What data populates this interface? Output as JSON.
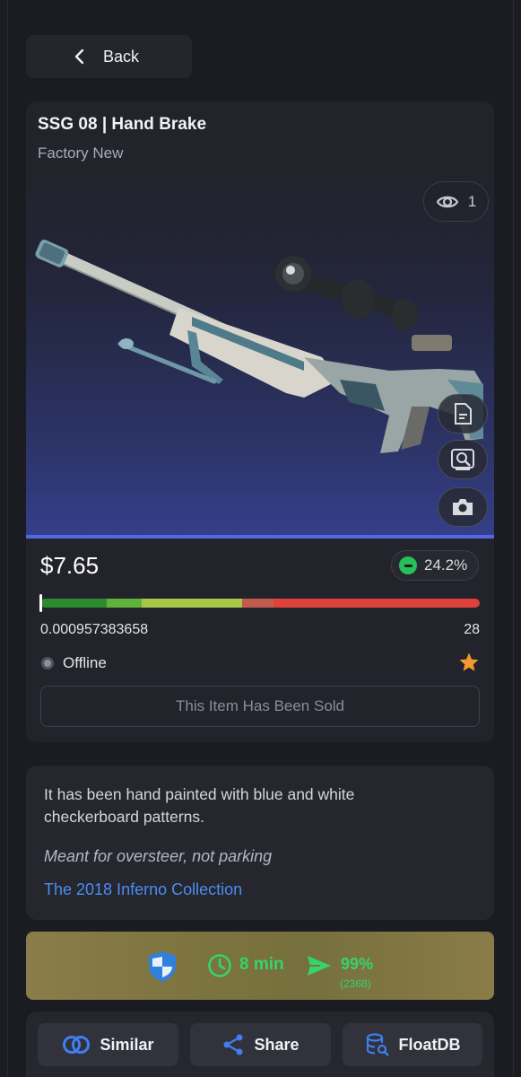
{
  "nav": {
    "back_label": "Back"
  },
  "item": {
    "name": "SSG 08 | Hand Brake",
    "wear": "Factory New",
    "views": "1",
    "price": "$7.65",
    "discount": "24.2%",
    "float_value": "0.000957383658",
    "float_right": "28",
    "float_position": 0.000957383658,
    "status": "Offline",
    "sold_label": "This Item Has Been Sold",
    "accent_color": "#5566e6"
  },
  "description": {
    "text": "It has been hand painted with blue and white checkerboard patterns.",
    "quote": "Meant for oversteer, not parking",
    "collection": "The 2018 Inferno Collection"
  },
  "trade": {
    "time": "8 min",
    "success_rate": "99%",
    "trades_count": "(2368)"
  },
  "actions": {
    "similar_label": "Similar",
    "share_label": "Share",
    "floatdb_label": "FloatDB"
  },
  "icons": [
    "chevron-left-icon",
    "eye-icon",
    "document-icon",
    "inspect-icon",
    "camera-icon",
    "minus-icon",
    "star-icon",
    "shield-icon",
    "clock-icon",
    "send-icon",
    "rings-icon",
    "share-icon",
    "database-search-icon"
  ]
}
